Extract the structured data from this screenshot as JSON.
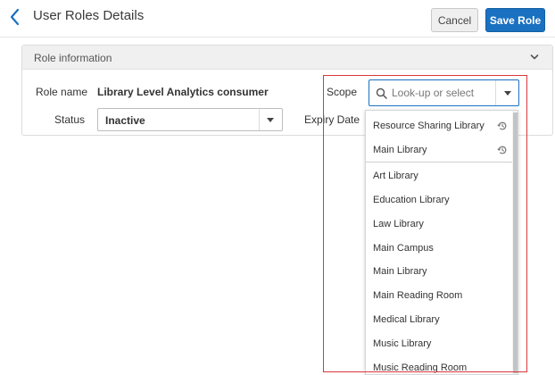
{
  "header": {
    "title": "User Roles Details",
    "cancel_label": "Cancel",
    "save_label": "Save Role"
  },
  "panel": {
    "title": "Role information"
  },
  "form": {
    "role_name_label": "Role name",
    "role_name_value": "Library Level Analytics consumer",
    "status_label": "Status",
    "status_value": "Inactive",
    "scope_label": "Scope",
    "scope_placeholder": "Look-up or select",
    "expiry_label": "Expiry Date"
  },
  "scope_dropdown": {
    "recent_items": [
      {
        "label": "Resource Sharing Library",
        "icon": "history-icon"
      },
      {
        "label": "Main Library",
        "icon": "history-icon"
      }
    ],
    "items": [
      {
        "label": "Art Library"
      },
      {
        "label": "Education Library"
      },
      {
        "label": "Law Library"
      },
      {
        "label": "Main Campus"
      },
      {
        "label": "Main Library"
      },
      {
        "label": "Main Reading Room"
      },
      {
        "label": "Medical Library"
      },
      {
        "label": "Music Library"
      },
      {
        "label": "Music Reading Room"
      }
    ]
  },
  "colors": {
    "accent": "#1a71c1",
    "highlight_box": "#d9383c"
  }
}
